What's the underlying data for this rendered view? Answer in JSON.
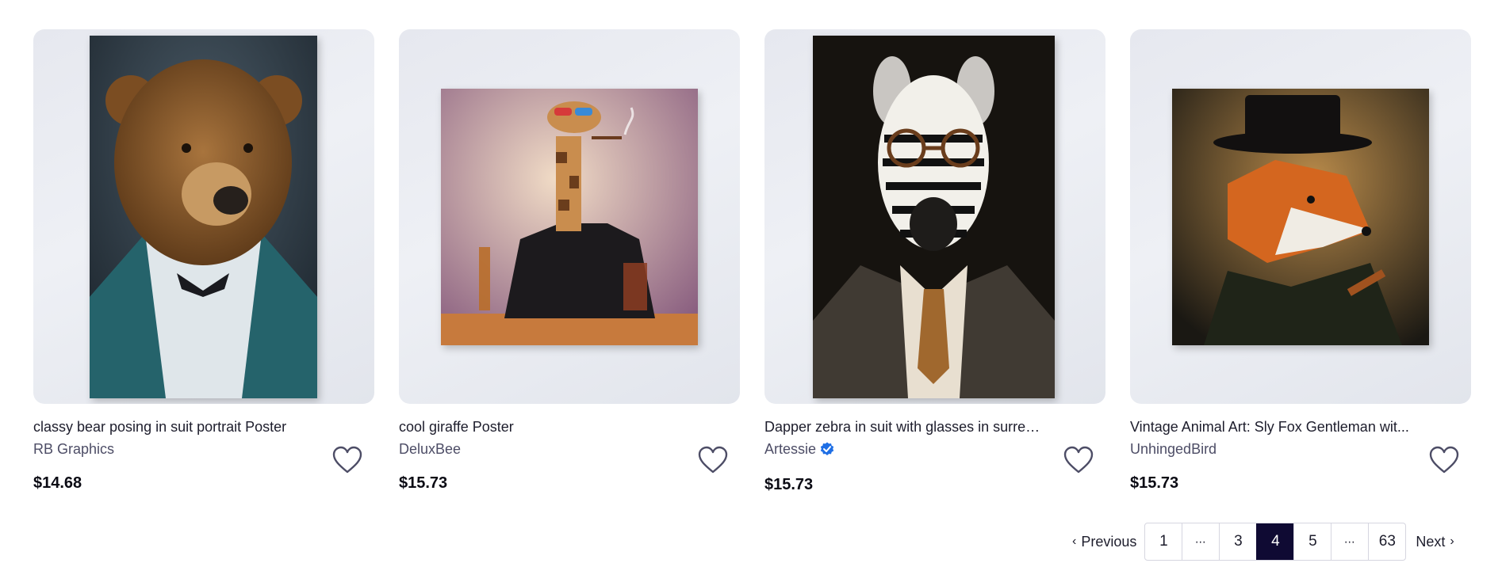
{
  "products": [
    {
      "title": "classy bear posing in suit portrait Poster",
      "artist": "RB Graphics",
      "verified": false,
      "price": "$14.68",
      "image_icon": "bear-portrait"
    },
    {
      "title": "cool giraffe Poster",
      "artist": "DeluxBee",
      "verified": false,
      "price": "$15.73",
      "image_icon": "giraffe-portrait"
    },
    {
      "title": "Dapper zebra in suit with glasses in surrea...",
      "artist": "Artessie",
      "verified": true,
      "price": "$15.73",
      "image_icon": "zebra-portrait"
    },
    {
      "title": "Vintage Animal Art: Sly Fox Gentleman wit...",
      "artist": "UnhingedBird",
      "verified": false,
      "price": "$15.73",
      "image_icon": "fox-portrait"
    }
  ],
  "pagination": {
    "previous_label": "Previous",
    "next_label": "Next",
    "prev_icon": "chevron-left-icon",
    "next_icon": "chevron-right-icon",
    "pages": [
      "1",
      "⋯",
      "3",
      "4",
      "5",
      "⋯",
      "63"
    ],
    "current": "4"
  },
  "colors": {
    "active_page_bg": "#0f0a33",
    "verified_badge": "#1f6fe5",
    "favorite_outline": "#4d4d66"
  }
}
